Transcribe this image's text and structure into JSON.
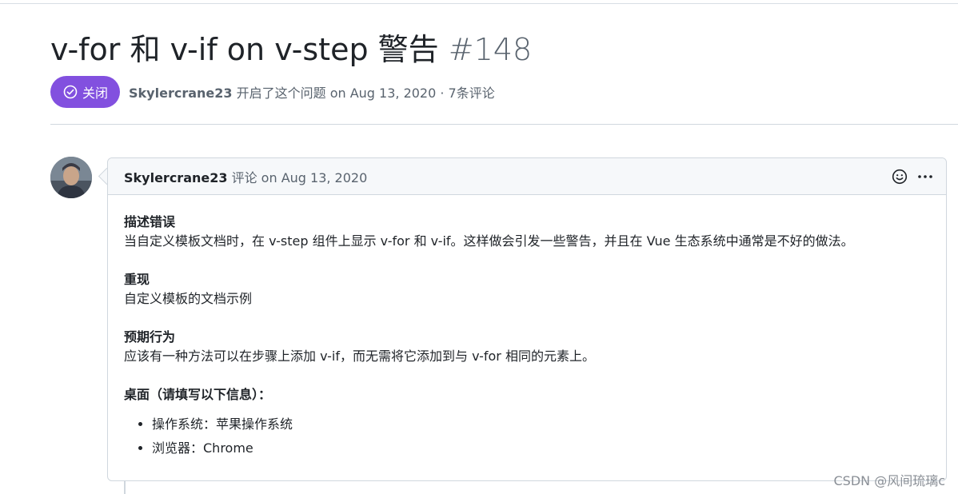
{
  "issue": {
    "title": "v-for 和 v-if on v-step 警告",
    "number": "#148",
    "state_label": "关闭",
    "state_color": "#8250df",
    "author": "Skylercrane23",
    "opened_text": "开启了这个问题 on Aug 13, 2020 · 7条评论"
  },
  "comment": {
    "author": "Skylercrane23",
    "action_text": "评论 on Aug 13, 2020",
    "icons": [
      "smiley-icon",
      "kebab-horizontal-icon"
    ],
    "sections": [
      {
        "title": "描述错误",
        "text": "当自定义模板文档时，在 v-step 组件上显示 v-for 和 v-if。这样做会引发一些警告，并且在 Vue 生态系统中通常是不好的做法。"
      },
      {
        "title": "重现",
        "text": "自定义模板的文档示例"
      },
      {
        "title": "预期行为",
        "text": "应该有一种方法可以在步骤上添加 v-if，而无需将它添加到与 v-for 相同的元素上。"
      },
      {
        "title": "桌面（请填写以下信息）："
      }
    ],
    "list_items": [
      "操作系统：苹果操作系统",
      "浏览器：Chrome"
    ]
  },
  "watermark": "CSDN @风间琉璃c"
}
